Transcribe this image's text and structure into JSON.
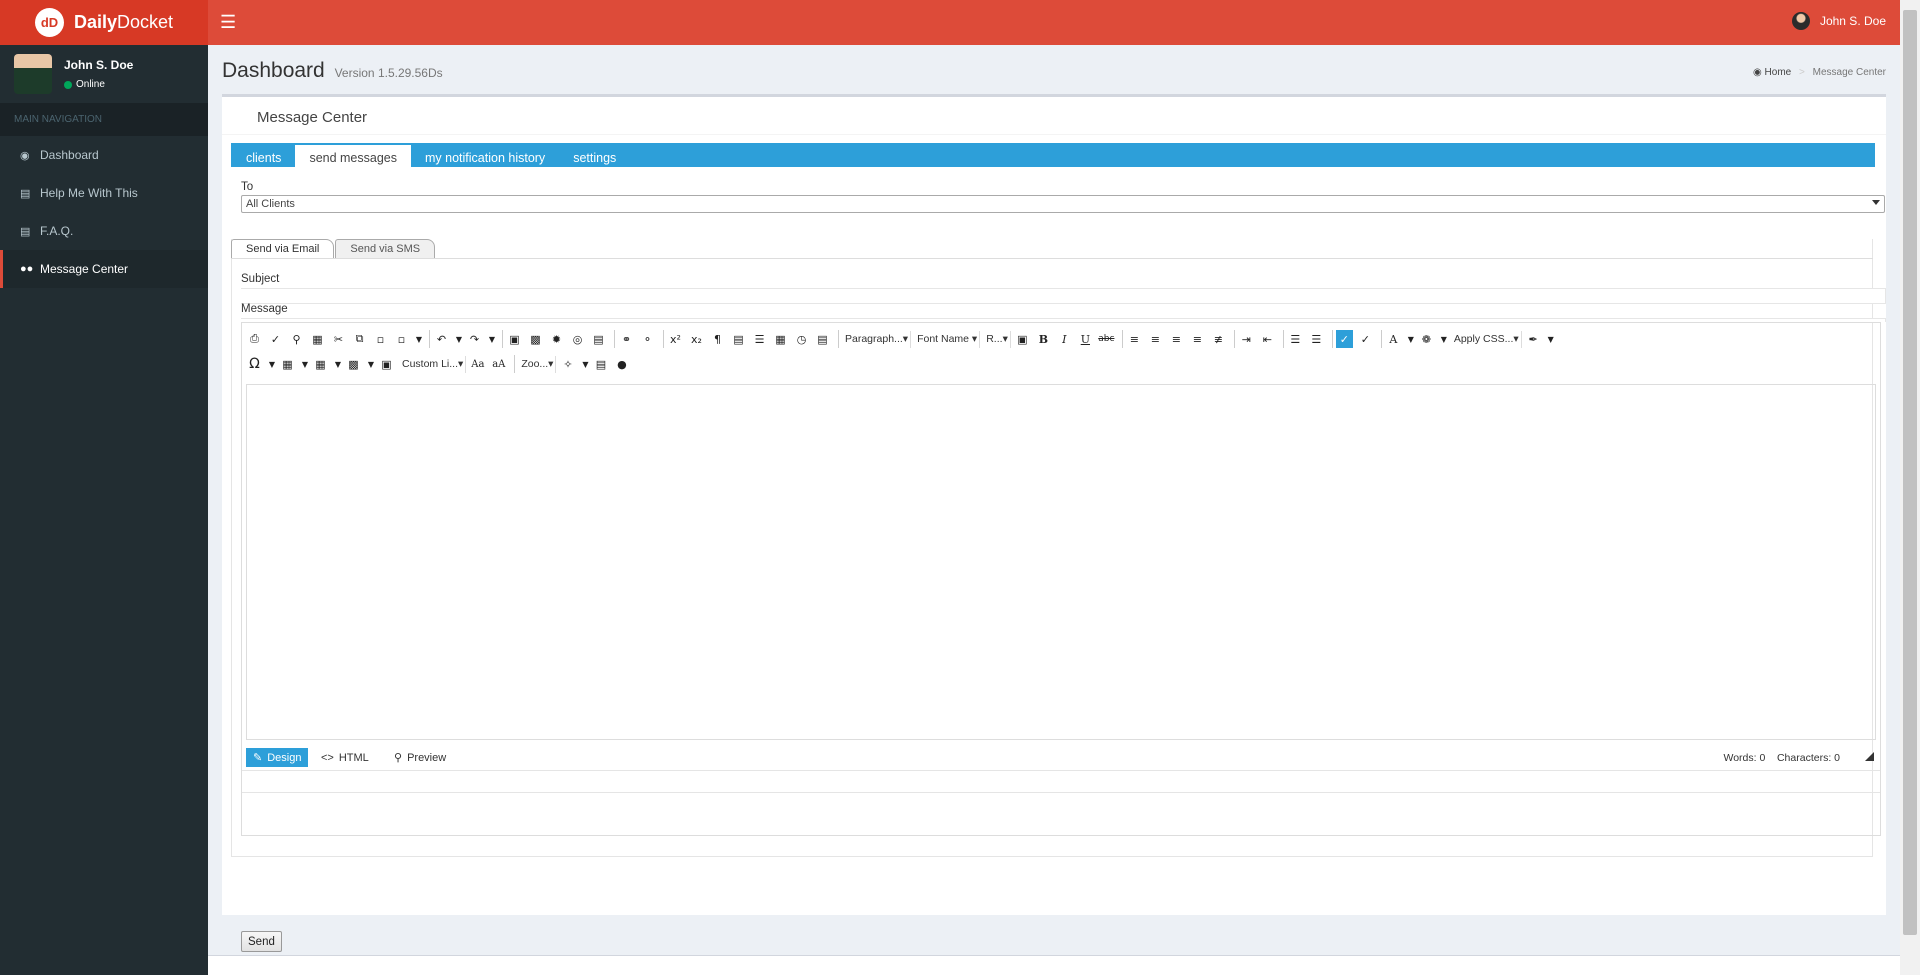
{
  "app": {
    "name_bold": "Daily",
    "name_rest": "Docket"
  },
  "header": {
    "menu_icon": "hamburger-icon",
    "user_name": "John S. Doe"
  },
  "sidebar": {
    "user": {
      "name": "John S. Doe",
      "status": "Online",
      "status_color": "#00a65a"
    },
    "nav_header": "MAIN NAVIGATION",
    "items": [
      {
        "label": "Dashboard",
        "icon": "dashboard-icon"
      },
      {
        "label": "Help Me With This",
        "icon": "book-icon"
      },
      {
        "label": "F.A.Q.",
        "icon": "book-icon"
      },
      {
        "label": "Message Center",
        "icon": "users-icon",
        "active": true
      }
    ]
  },
  "page": {
    "title": "Dashboard",
    "version": "Version 1.5.29.56Ds",
    "breadcrumb": {
      "home": "Home",
      "current": "Message Center"
    }
  },
  "message_center": {
    "title": "Message Center",
    "tabs": [
      "clients",
      "send messages",
      "my notification history",
      "settings"
    ],
    "active_tab": "send messages",
    "to_label": "To",
    "to_value": "All Clients",
    "send_tabs": [
      "Send via Email",
      "Send via SMS"
    ],
    "subject_label": "Subject",
    "message_label": "Message",
    "send_label": "Send"
  },
  "editor": {
    "dropdowns": {
      "paragraph": "Paragraph...",
      "font_name": "Font Name",
      "size": "R...",
      "apply_css": "Apply CSS...",
      "custom_links": "Custom Li...",
      "zoom": "Zoo..."
    },
    "modes": [
      "Design",
      "HTML",
      "Preview"
    ],
    "words": "Words: 0",
    "characters": "Characters: 0"
  },
  "colors": {
    "header": "#dd4b39",
    "sidebar": "#222d32",
    "accent": "#2d9fd9"
  }
}
